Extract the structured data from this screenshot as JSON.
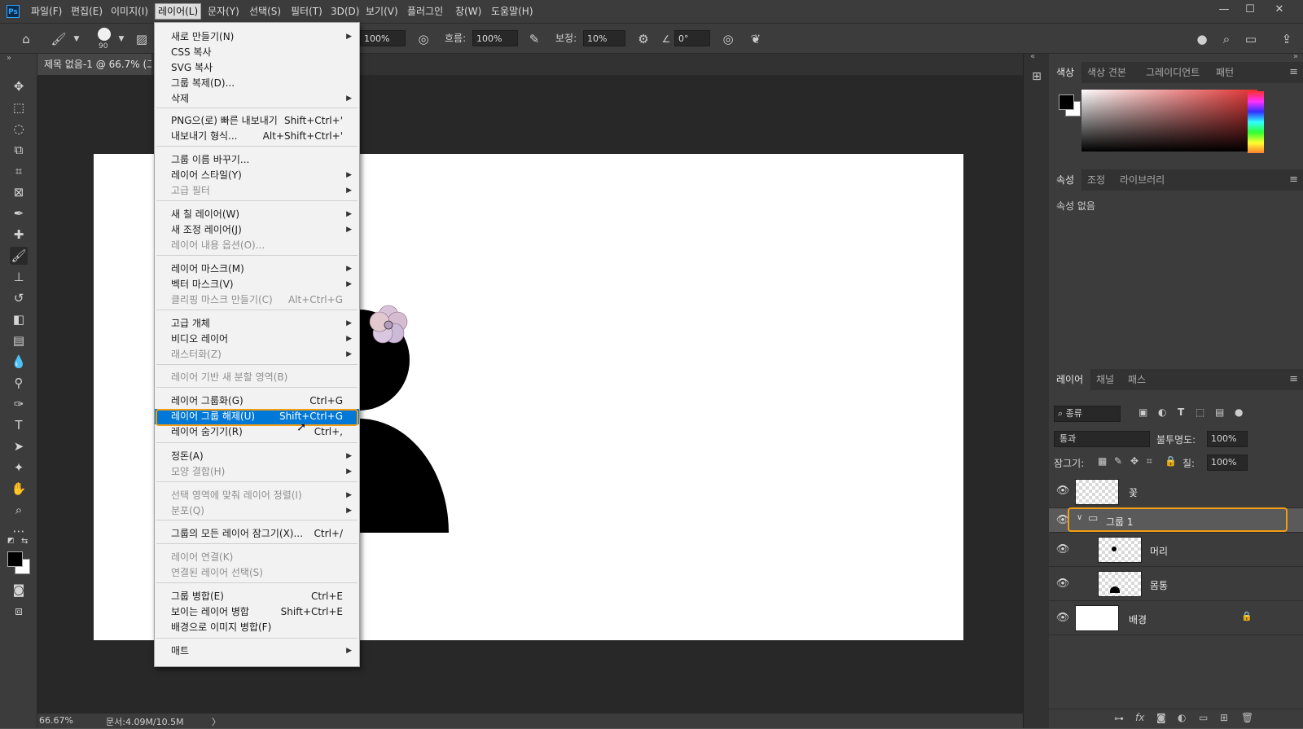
{
  "app": {
    "logo": "Ps",
    "menus": [
      "파일(F)",
      "편집(E)",
      "이미지(I)",
      "레이어(L)",
      "문자(Y)",
      "선택(S)",
      "필터(T)",
      "3D(D)",
      "보기(V)",
      "플러그인",
      "창(W)",
      "도움말(H)"
    ],
    "active_menu": "레이어(L)",
    "window_controls": [
      "minimize-icon",
      "maximize-icon",
      "close-icon"
    ]
  },
  "options": {
    "brush_size": "90",
    "opacity_value": "100%",
    "flow_label": "흐름:",
    "flow_value": "100%",
    "smoothing_label": "보정:",
    "smoothing_value": "10%",
    "angle_value": "0°"
  },
  "document": {
    "tab_title": "제목 없음-1 @ 66.7% (그...",
    "zoom": "66.67%",
    "doc_info": "문서:4.09M/10.5M",
    "status_arrow": "〉"
  },
  "layer_menu": {
    "items": [
      {
        "label": "새로 만들기(N)",
        "shortcut": "",
        "submenu": true,
        "disabled": false
      },
      {
        "label": "CSS 복사",
        "shortcut": "",
        "submenu": false,
        "disabled": false
      },
      {
        "label": "SVG 복사",
        "shortcut": "",
        "submenu": false,
        "disabled": false
      },
      {
        "label": "그룹 복제(D)...",
        "shortcut": "",
        "submenu": false,
        "disabled": false
      },
      {
        "label": "삭제",
        "shortcut": "",
        "submenu": true,
        "disabled": false
      },
      {
        "label": "PNG으(로) 빠른 내보내기",
        "shortcut": "Shift+Ctrl+'",
        "submenu": false,
        "disabled": false
      },
      {
        "label": "내보내기 형식...",
        "shortcut": "Alt+Shift+Ctrl+'",
        "submenu": false,
        "disabled": false
      },
      {
        "label": "그룹 이름 바꾸기...",
        "shortcut": "",
        "submenu": false,
        "disabled": false
      },
      {
        "label": "레이어 스타일(Y)",
        "shortcut": "",
        "submenu": true,
        "disabled": false
      },
      {
        "label": "고급 필터",
        "shortcut": "",
        "submenu": true,
        "disabled": true
      },
      {
        "label": "새 칠 레이어(W)",
        "shortcut": "",
        "submenu": true,
        "disabled": false
      },
      {
        "label": "새 조정 레이어(J)",
        "shortcut": "",
        "submenu": true,
        "disabled": false
      },
      {
        "label": "레이어 내용 옵션(O)...",
        "shortcut": "",
        "submenu": false,
        "disabled": true
      },
      {
        "label": "레이어 마스크(M)",
        "shortcut": "",
        "submenu": true,
        "disabled": false
      },
      {
        "label": "벡터 마스크(V)",
        "shortcut": "",
        "submenu": true,
        "disabled": false
      },
      {
        "label": "클리핑 마스크 만들기(C)",
        "shortcut": "Alt+Ctrl+G",
        "submenu": false,
        "disabled": true
      },
      {
        "label": "고급 개체",
        "shortcut": "",
        "submenu": true,
        "disabled": false
      },
      {
        "label": "비디오 레이어",
        "shortcut": "",
        "submenu": true,
        "disabled": false
      },
      {
        "label": "래스터화(Z)",
        "shortcut": "",
        "submenu": true,
        "disabled": true
      },
      {
        "label": "레이어 기반 새 분할 영역(B)",
        "shortcut": "",
        "submenu": false,
        "disabled": true
      },
      {
        "label": "레이어 그룹화(G)",
        "shortcut": "Ctrl+G",
        "submenu": false,
        "disabled": false
      },
      {
        "label": "레이어 그룹 해제(U)",
        "shortcut": "Shift+Ctrl+G",
        "submenu": false,
        "disabled": false,
        "highlighted": true
      },
      {
        "label": "레이어 숨기기(R)",
        "shortcut": "Ctrl+,",
        "submenu": false,
        "disabled": false
      },
      {
        "label": "정돈(A)",
        "shortcut": "",
        "submenu": true,
        "disabled": false
      },
      {
        "label": "모양 결합(H)",
        "shortcut": "",
        "submenu": true,
        "disabled": true
      },
      {
        "label": "선택 영역에 맞춰 레이어 정렬(I)",
        "shortcut": "",
        "submenu": true,
        "disabled": true
      },
      {
        "label": "분포(Q)",
        "shortcut": "",
        "submenu": true,
        "disabled": true
      },
      {
        "label": "그룹의 모든 레이어 잠그기(X)...",
        "shortcut": "Ctrl+/",
        "submenu": false,
        "disabled": false
      },
      {
        "label": "레이어 연결(K)",
        "shortcut": "",
        "submenu": false,
        "disabled": true
      },
      {
        "label": "연결된 레이어 선택(S)",
        "shortcut": "",
        "submenu": false,
        "disabled": true
      },
      {
        "label": "그룹 병합(E)",
        "shortcut": "Ctrl+E",
        "submenu": false,
        "disabled": false
      },
      {
        "label": "보이는 레이어 병합",
        "shortcut": "Shift+Ctrl+E",
        "submenu": false,
        "disabled": false
      },
      {
        "label": "배경으로 이미지 병합(F)",
        "shortcut": "",
        "submenu": false,
        "disabled": false
      },
      {
        "label": "매트",
        "shortcut": "",
        "submenu": true,
        "disabled": false
      }
    ]
  },
  "color_panel": {
    "tabs": [
      "색상",
      "색상 견본",
      "그레이디언트",
      "패턴"
    ],
    "active_tab": "색상",
    "foreground": "#000000",
    "background": "#ffffff",
    "hue": "#e03030"
  },
  "properties_panel": {
    "tabs": [
      "속성",
      "조정",
      "라이브러리"
    ],
    "active_tab": "속성",
    "empty_text": "속성 없음"
  },
  "layers_panel": {
    "tabs": [
      "레이어",
      "채널",
      "패스"
    ],
    "active_tab": "레이어",
    "filter_label": "종류",
    "blend_mode": "통과",
    "opacity_label": "불투명도:",
    "opacity_value": "100%",
    "lock_label": "잠그기:",
    "fill_label": "칠:",
    "fill_value": "100%",
    "layers": [
      {
        "name": "꽃",
        "type": "layer",
        "indent": false,
        "selected": false,
        "locked": false
      },
      {
        "name": "그룹 1",
        "type": "group",
        "indent": false,
        "selected": true,
        "locked": false
      },
      {
        "name": "머리",
        "type": "layer",
        "indent": true,
        "selected": false,
        "locked": false
      },
      {
        "name": "몸통",
        "type": "layer",
        "indent": true,
        "selected": false,
        "locked": false
      },
      {
        "name": "배경",
        "type": "background",
        "indent": false,
        "selected": false,
        "locked": true
      }
    ]
  },
  "colors": {
    "highlight": "#0078d7",
    "annotation": "#f29d13",
    "flower_petal": "#d9c3d8"
  }
}
